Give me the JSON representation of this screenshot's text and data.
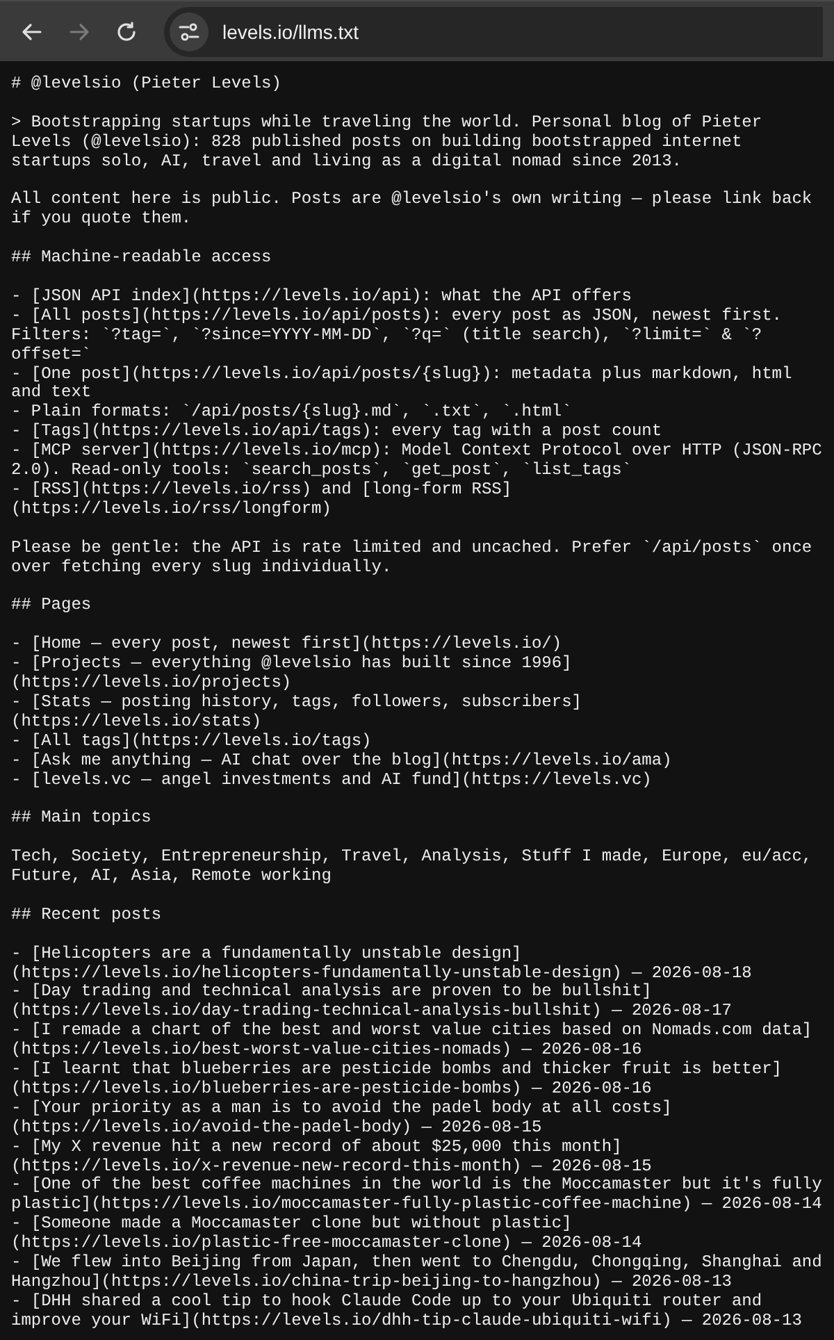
{
  "toolbar": {
    "back": {
      "disabled": false
    },
    "forward": {
      "disabled": true
    },
    "url": "levels.io/llms.txt"
  },
  "document": {
    "blocks": [
      [
        "# @levelsio (Pieter Levels)"
      ],
      [
        "> Bootstrapping startups while traveling the world. Personal blog of Pieter Levels (@levelsio): 828 published posts on building bootstrapped internet startups solo, AI, travel and living as a digital nomad since 2013."
      ],
      [
        "All content here is public. Posts are @levelsio's own writing — please link back if you quote them."
      ],
      [
        "## Machine-readable access"
      ],
      [
        "- [JSON API index](https://levels.io/api): what the API offers",
        "- [All posts](https://levels.io/api/posts): every post as JSON, newest first. Filters: `?tag=`, `?since=YYYY-MM-DD`, `?q=` (title search), `?limit=` & `?offset=`",
        "- [One post](https://levels.io/api/posts/{slug}): metadata plus markdown, html and text",
        "- Plain formats: `/api/posts/{slug}.md`, `.txt`, `.html`",
        "- [Tags](https://levels.io/api/tags): every tag with a post count",
        "- [MCP server](https://levels.io/mcp): Model Context Protocol over HTTP (JSON-RPC 2.0). Read-only tools: `search_posts`, `get_post`, `list_tags`",
        "- [RSS](https://levels.io/rss) and [long-form RSS](https://levels.io/rss/longform)"
      ],
      [
        "Please be gentle: the API is rate limited and uncached. Prefer `/api/posts` once over fetching every slug individually."
      ],
      [
        "## Pages"
      ],
      [
        "- [Home — every post, newest first](https://levels.io/)",
        "- [Projects — everything @levelsio has built since 1996](https://levels.io/projects)",
        "- [Stats — posting history, tags, followers, subscribers](https://levels.io/stats)",
        "- [All tags](https://levels.io/tags)",
        "- [Ask me anything — AI chat over the blog](https://levels.io/ama)",
        "- [levels.vc — angel investments and AI fund](https://levels.vc)"
      ],
      [
        "## Main topics"
      ],
      [
        "Tech, Society, Entrepreneurship, Travel, Analysis, Stuff I made, Europe, eu/acc, Future, AI, Asia, Remote working"
      ],
      [
        "## Recent posts"
      ],
      [
        "- [Helicopters are a fundamentally unstable design](https://levels.io/helicopters-fundamentally-unstable-design) — 2026-08-18",
        "- [Day trading and technical analysis are proven to be bullshit](https://levels.io/day-trading-technical-analysis-bullshit) — 2026-08-17",
        "- [I remade a chart of the best and worst value cities based on Nomads.com data](https://levels.io/best-worst-value-cities-nomads) — 2026-08-16",
        "- [I learnt that blueberries are pesticide bombs and thicker fruit is better](https://levels.io/blueberries-are-pesticide-bombs) — 2026-08-16",
        "- [Your priority as a man is to avoid the padel body at all costs](https://levels.io/avoid-the-padel-body) — 2026-08-15",
        "- [My X revenue hit a new record of about $25,000 this month](https://levels.io/x-revenue-new-record-this-month) — 2026-08-15",
        "- [One of the best coffee machines in the world is the Moccamaster but it's fully plastic](https://levels.io/moccamaster-fully-plastic-coffee-machine) — 2026-08-14",
        "- [Someone made a Moccamaster clone but without plastic](https://levels.io/plastic-free-moccamaster-clone) — 2026-08-14",
        "- [We flew into Beijing from Japan, then went to Chengdu, Chongqing, Shanghai and Hangzhou](https://levels.io/china-trip-beijing-to-hangzhou) — 2026-08-13",
        "- [DHH shared a cool tip to hook Claude Code up to your Ubiquiti router and improve your WiFi](https://levels.io/dhh-tip-claude-ubiquiti-wifi) — 2026-08-13"
      ]
    ]
  }
}
